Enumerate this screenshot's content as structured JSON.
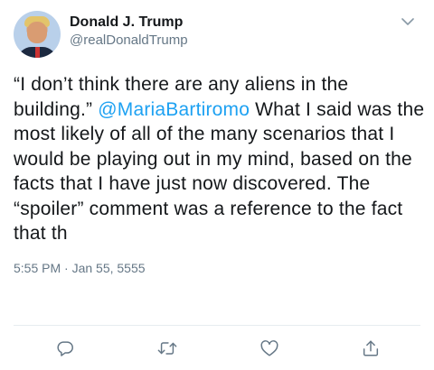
{
  "user": {
    "display_name": "Donald J. Trump",
    "handle": "@realDonaldTrump"
  },
  "tweet": {
    "text_before": "“I don’t think there are any aliens in the building.” ",
    "mention": "@MariaBartiromo",
    "text_after": " What I said was the most likely of all of the many scenarios that I would be playing out in my mind, based on the facts that I have just now discovered. The “spoiler” comment was a reference to the fact that th",
    "timestamp": "5:55 PM · Jan 55, 5555"
  },
  "icons": {
    "menu": "chevron-down-icon",
    "reply": "reply-icon",
    "retweet": "retweet-icon",
    "like": "heart-icon",
    "share": "share-icon"
  },
  "colors": {
    "text": "#14171a",
    "secondary": "#657786",
    "link": "#1da1f2",
    "divider": "#e6ecf0"
  }
}
